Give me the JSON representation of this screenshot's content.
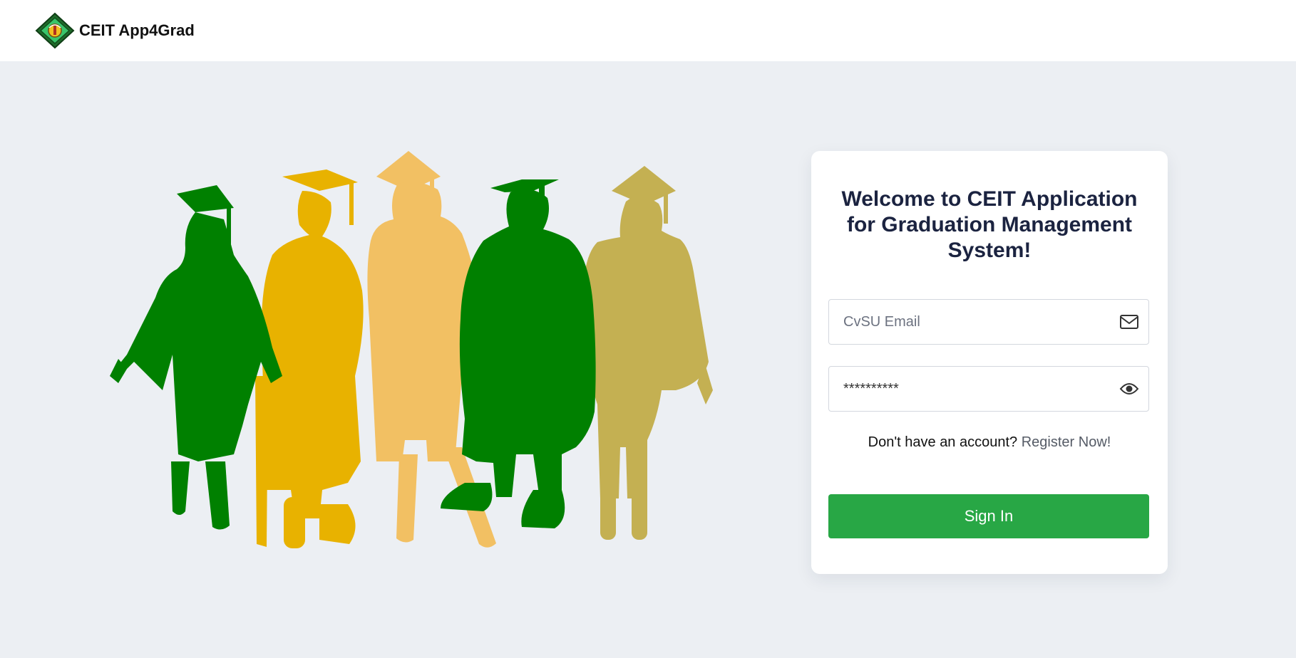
{
  "navbar": {
    "brand_name": "CEIT App4Grad",
    "logo_icon": "ceit-logo-diamond"
  },
  "colors": {
    "green": "#008000",
    "gold": "#e8b200",
    "light_gold": "#f2c063",
    "olive_gold": "#c4b052",
    "button_green": "#28a745",
    "title_navy": "#1b2340",
    "page_bg": "#eceff3"
  },
  "illustration": {
    "icon": "graduates-silhouette-illustration"
  },
  "login": {
    "title": "Welcome to CEIT Application for Graduation Management System!",
    "email_placeholder": "CvSU Email",
    "email_icon": "envelope-icon",
    "password_value": "**********",
    "password_icon": "eye-icon",
    "register_prompt": "Don't have an account?",
    "register_link": "Register Now!",
    "signin_label": "Sign In"
  }
}
